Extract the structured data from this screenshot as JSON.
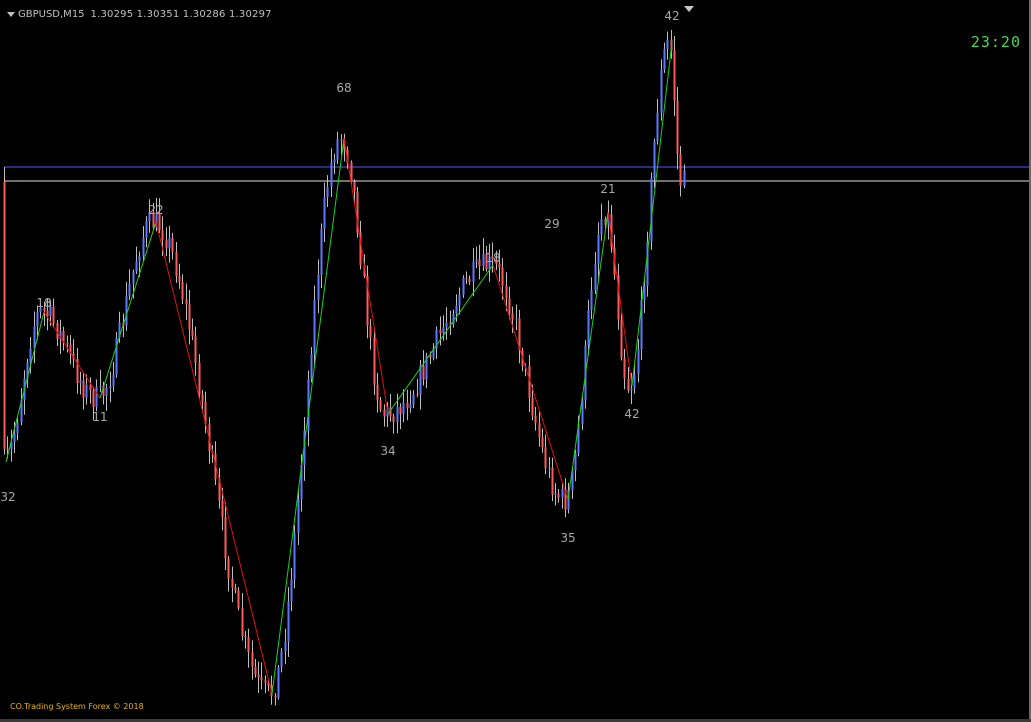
{
  "window": {
    "symbol": "GBPUSD,M15",
    "ohlc": "1.30295 1.30351 1.30286 1.30297",
    "clock": "23:20",
    "copyright": "CO.Trading System Forex © 2018"
  },
  "colors": {
    "background": "#000000",
    "bull_candle": "#5b78ff",
    "bear_candle": "#ff5a5a",
    "wick": "#bdbdbd",
    "zigzag_up": "#18d418",
    "zigzag_down": "#e01010",
    "label_text": "#a8a8a8",
    "hline_blue": "#4a5cff",
    "hline_white": "#e0e0e0",
    "clock": "#4cd74c",
    "copyright": "#e8b400"
  },
  "icons": {
    "menu_triangle": "triangle-down-icon",
    "shift_marker": "triangle-down-icon"
  },
  "swing_labels": [
    "32",
    "18",
    "11",
    "22",
    "68",
    "34",
    "18",
    "29",
    "35",
    "21",
    "42",
    "42"
  ]
}
